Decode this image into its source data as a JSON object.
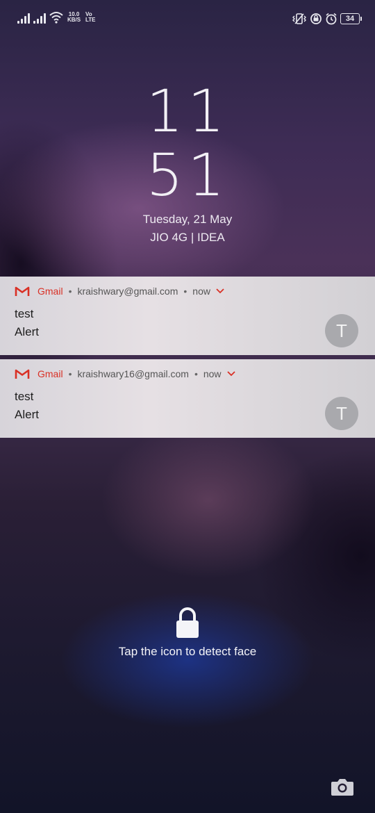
{
  "status_bar": {
    "speed_value": "10.0",
    "speed_unit": "KB/S",
    "volte_top": "Vo",
    "volte_bottom": "LTE",
    "battery": "34",
    "icons": [
      "signal-icon",
      "signal-icon",
      "wifi-icon",
      "vibrate-icon",
      "data-saver-icon",
      "alarm-icon",
      "battery-icon"
    ]
  },
  "clock": {
    "hour": "11",
    "minute": "51",
    "date": "Tuesday, 21 May",
    "carrier": "JIO 4G | IDEA"
  },
  "notifications": [
    {
      "app": "Gmail",
      "account": "kraishwary@gmail.com",
      "time": "now",
      "title": "test",
      "body": "Alert",
      "avatar": "T"
    },
    {
      "app": "Gmail",
      "account": "kraishwary16@gmail.com",
      "time": "now",
      "title": "test",
      "body": "Alert",
      "avatar": "T"
    }
  ],
  "face_unlock": {
    "text": "Tap the icon to detect face"
  },
  "colors": {
    "gmail_red": "#d93025",
    "notification_bg": "#dedadf",
    "avatar_bg": "#a9a9ad"
  }
}
